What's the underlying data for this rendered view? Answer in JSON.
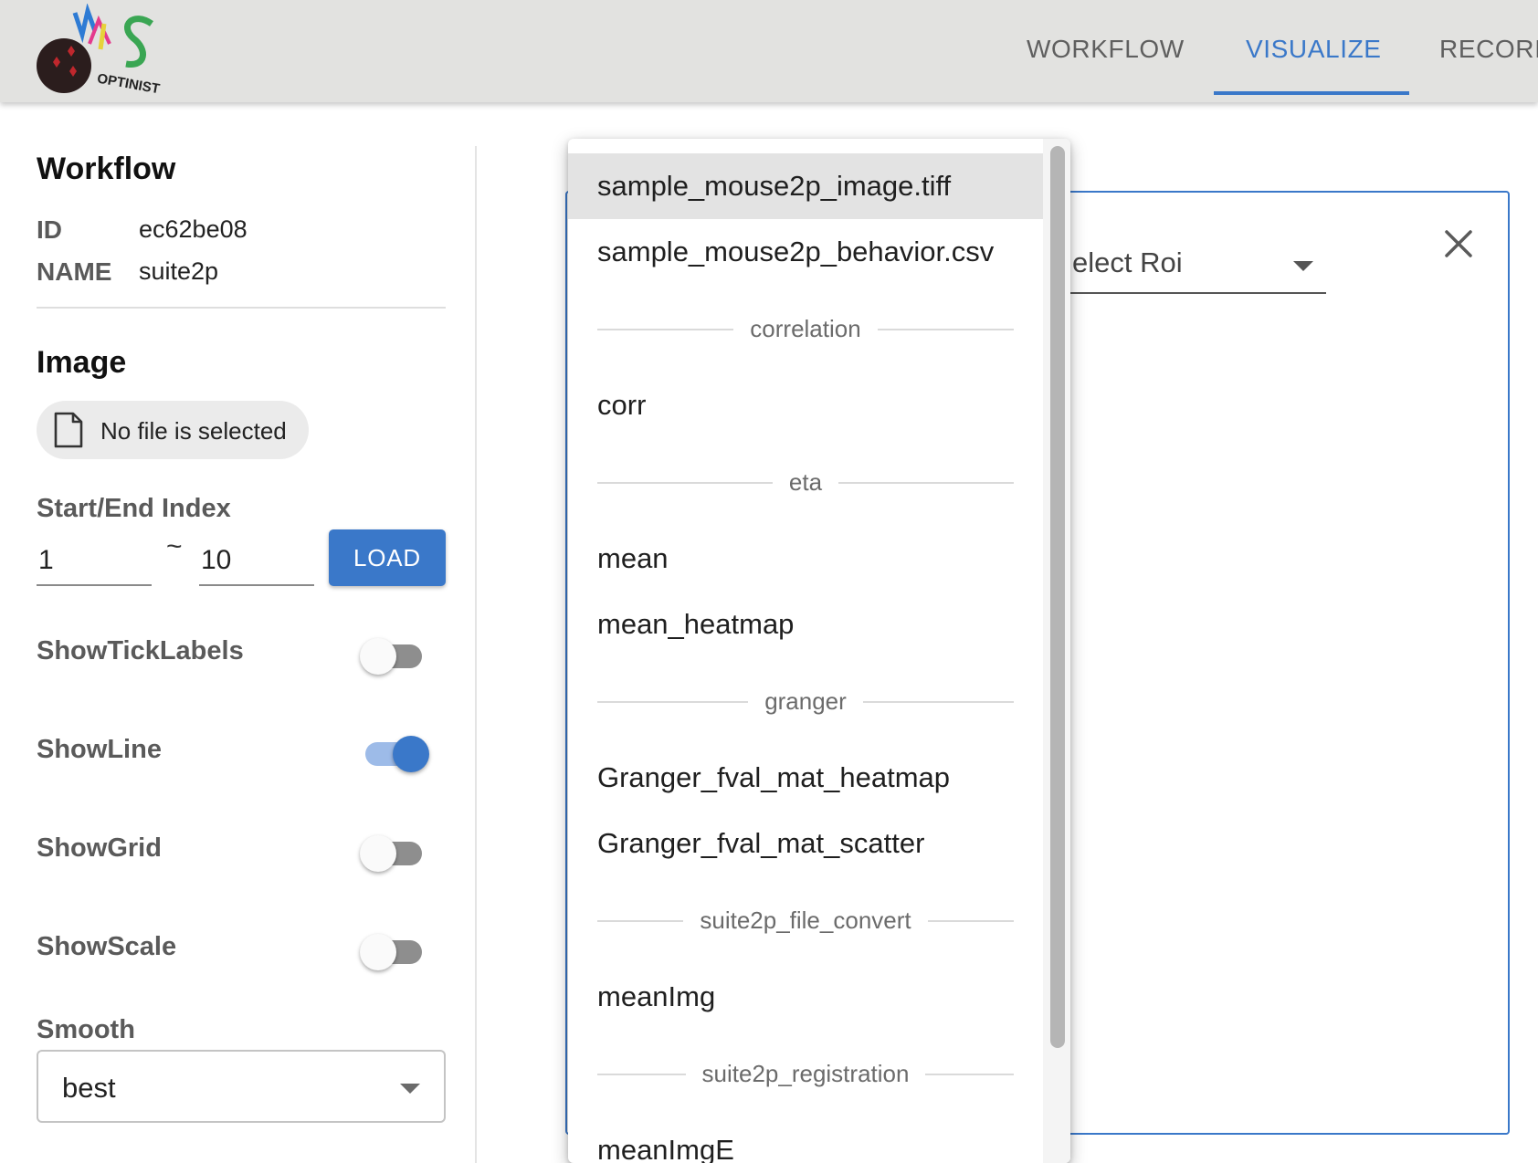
{
  "header": {
    "logo_text": "OPTINIST",
    "tabs": [
      {
        "label": "WORKFLOW",
        "active": false
      },
      {
        "label": "VISUALIZE",
        "active": true
      },
      {
        "label": "RECORI",
        "active": false
      }
    ],
    "accent_color": "#3a78c9"
  },
  "sidebar": {
    "workflow_title": "Workflow",
    "id_label": "ID",
    "id_value": "ec62be08",
    "name_label": "NAME",
    "name_value": "suite2p",
    "image_title": "Image",
    "file_chip": {
      "icon": "file-icon",
      "label": "No file is selected"
    },
    "index": {
      "label": "Start/End Index",
      "start": "1",
      "separator": "~",
      "end": "10",
      "load_label": "LOAD"
    },
    "toggles": [
      {
        "label": "ShowTickLabels",
        "on": false
      },
      {
        "label": "ShowLine",
        "on": true
      },
      {
        "label": "ShowGrid",
        "on": false
      },
      {
        "label": "ShowScale",
        "on": false
      }
    ],
    "smooth": {
      "label": "Smooth",
      "value": "best"
    }
  },
  "main": {
    "roi_select_text": "elect Roi",
    "close_icon": "close-icon"
  },
  "menu": {
    "items": [
      {
        "type": "item",
        "label": "sample_mouse2p_image.tiff",
        "selected": true
      },
      {
        "type": "item",
        "label": "sample_mouse2p_behavior.csv"
      },
      {
        "type": "subheader",
        "label": "correlation"
      },
      {
        "type": "item",
        "label": "corr"
      },
      {
        "type": "subheader",
        "label": "eta"
      },
      {
        "type": "item",
        "label": "mean"
      },
      {
        "type": "item",
        "label": "mean_heatmap"
      },
      {
        "type": "subheader",
        "label": "granger"
      },
      {
        "type": "item",
        "label": "Granger_fval_mat_heatmap"
      },
      {
        "type": "item",
        "label": "Granger_fval_mat_scatter"
      },
      {
        "type": "subheader",
        "label": "suite2p_file_convert"
      },
      {
        "type": "item",
        "label": "meanImg"
      },
      {
        "type": "subheader",
        "label": "suite2p_registration"
      },
      {
        "type": "item",
        "label": "meanImgE"
      }
    ]
  }
}
